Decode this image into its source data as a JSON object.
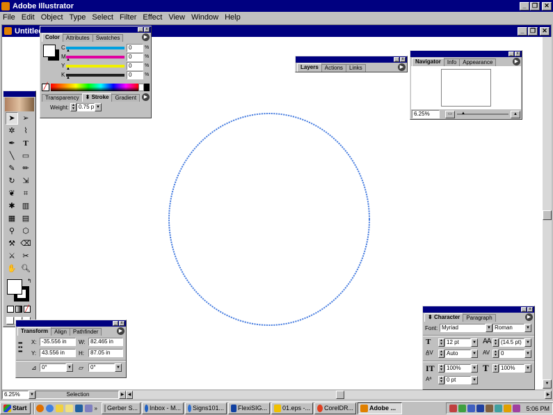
{
  "app": {
    "title": "Adobe Illustrator",
    "menu": [
      "File",
      "Edit",
      "Object",
      "Type",
      "Select",
      "Filter",
      "Effect",
      "View",
      "Window",
      "Help"
    ]
  },
  "document": {
    "title": "Untitled",
    "zoom": "6.25%",
    "status": "Selection"
  },
  "color_palette": {
    "tabs": [
      "Color",
      "Attributes",
      "Swatches"
    ],
    "sliders": [
      {
        "label": "C",
        "value": "0",
        "unit": "%",
        "color": "#00a0e0"
      },
      {
        "label": "M",
        "value": "0",
        "unit": "%",
        "color": "#e000a0"
      },
      {
        "label": "Y",
        "value": "0",
        "unit": "%",
        "color": "#f0f000"
      },
      {
        "label": "K",
        "value": "0",
        "unit": "%",
        "color": "#202020"
      }
    ]
  },
  "stroke_palette": {
    "tabs": [
      "Transparency",
      "Stroke",
      "Gradient"
    ],
    "weight_label": "Weight:",
    "weight_value": "0.75 p"
  },
  "layers_palette": {
    "tabs": [
      "Layers",
      "Actions",
      "Links"
    ]
  },
  "navigator_palette": {
    "tabs": [
      "Navigator",
      "Info",
      "Appearance"
    ],
    "zoom": "6.25%"
  },
  "transform_palette": {
    "tabs": [
      "Transform",
      "Align",
      "Pathfinder"
    ],
    "x_label": "X:",
    "x_value": "-35.556 in",
    "y_label": "Y:",
    "y_value": "43.556 in",
    "w_label": "W:",
    "w_value": "82.465 in",
    "h_label": "H:",
    "h_value": "87.05 in",
    "rotate_value": "0°",
    "shear_value": "0°"
  },
  "character_palette": {
    "tabs": [
      "Character",
      "Paragraph"
    ],
    "font_label": "Font:",
    "font_value": "Myriad",
    "style_value": "Roman",
    "size_value": "12 pt",
    "leading_value": "(14.5 pt)",
    "kerning_value": "Auto",
    "tracking_value": "0",
    "vscale_value": "100%",
    "hscale_value": "100%",
    "baseline_value": "0 pt"
  },
  "taskbar": {
    "start": "Start",
    "items": [
      {
        "label": "Gerber S...",
        "color": "#808080"
      },
      {
        "label": "Inbox - M...",
        "color": "#2060c0"
      },
      {
        "label": "Signs101...",
        "color": "#3070d0"
      },
      {
        "label": "FlexiSIG...",
        "color": "#1040a0"
      },
      {
        "label": "01.eps -...",
        "color": "#f0c000"
      },
      {
        "label": "CorelDR...",
        "color": "#e04020"
      },
      {
        "label": "Adobe ...",
        "color": "#e08000",
        "active": true
      }
    ],
    "clock": "5:06 PM"
  },
  "colors": {
    "circle_stroke": "#4a7fe0",
    "title_blue": "#000080"
  }
}
